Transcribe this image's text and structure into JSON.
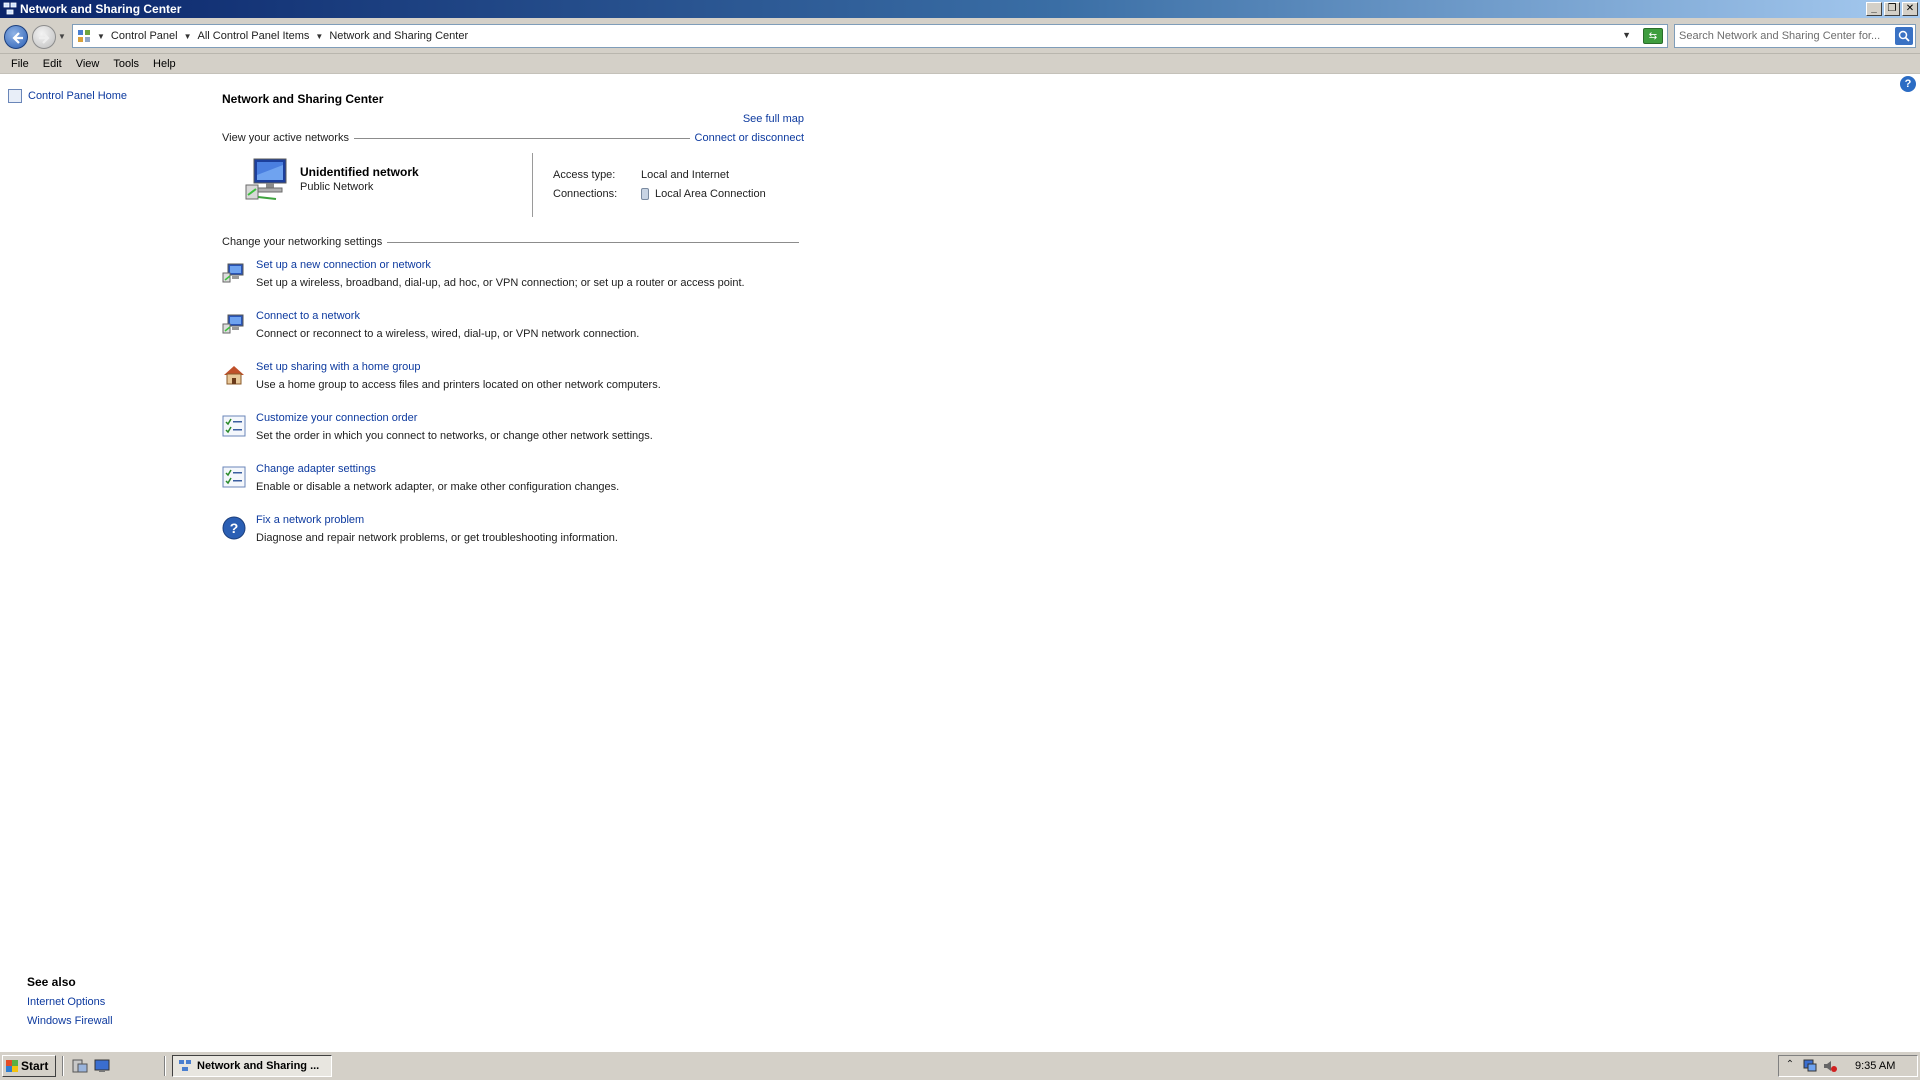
{
  "window": {
    "title": "Network and Sharing Center",
    "controls": [
      "_",
      "❐",
      "✕"
    ]
  },
  "address": {
    "crumbs": [
      "Control Panel",
      "All Control Panel Items",
      "Network and Sharing Center"
    ],
    "search_placeholder": "Search Network and Sharing Center for..."
  },
  "menu": [
    "File",
    "Edit",
    "View",
    "Tools",
    "Help"
  ],
  "left": {
    "home_link": "Control Panel Home",
    "see_also_title": "See also",
    "see_also_links": [
      "Internet Options",
      "Windows Firewall"
    ]
  },
  "main": {
    "title": "Network and Sharing Center",
    "see_full_map": "See full map",
    "active_networks_label": "View your active networks",
    "connect_disconnect": "Connect or disconnect",
    "network": {
      "name": "Unidentified network",
      "type": "Public Network",
      "access_type_label": "Access type:",
      "access_type_value": "Local and Internet",
      "connections_label": "Connections:",
      "connections_value": "Local Area Connection"
    },
    "change_settings_label": "Change your networking settings",
    "tasks": [
      {
        "title": "Set up a new connection or network",
        "desc": "Set up a wireless, broadband, dial-up, ad hoc, or VPN connection; or set up a router or access point.",
        "icon": "network-setup-icon"
      },
      {
        "title": "Connect to a network",
        "desc": "Connect or reconnect to a wireless, wired, dial-up, or VPN network connection.",
        "icon": "connect-network-icon"
      },
      {
        "title": "Set up sharing with a home group",
        "desc": "Use a home group to access files and printers located on other network computers.",
        "icon": "homegroup-icon"
      },
      {
        "title": "Customize your connection order",
        "desc": "Set the order in which you connect to networks, or change other network settings.",
        "icon": "checklist-icon"
      },
      {
        "title": "Change adapter settings",
        "desc": "Enable or disable a network adapter, or make other configuration changes.",
        "icon": "checklist-icon"
      },
      {
        "title": "Fix a network problem",
        "desc": "Diagnose and repair network problems, or get troubleshooting information.",
        "icon": "help-question-icon"
      }
    ]
  },
  "taskbar": {
    "start_label": "Start",
    "task_button_label": "Network and Sharing ...",
    "clock": "9:35 AM"
  },
  "colors": {
    "link": "#0d3a9f",
    "titlebar_start": "#0a246a",
    "titlebar_end": "#a6caf0",
    "chrome": "#d4d0c8"
  }
}
